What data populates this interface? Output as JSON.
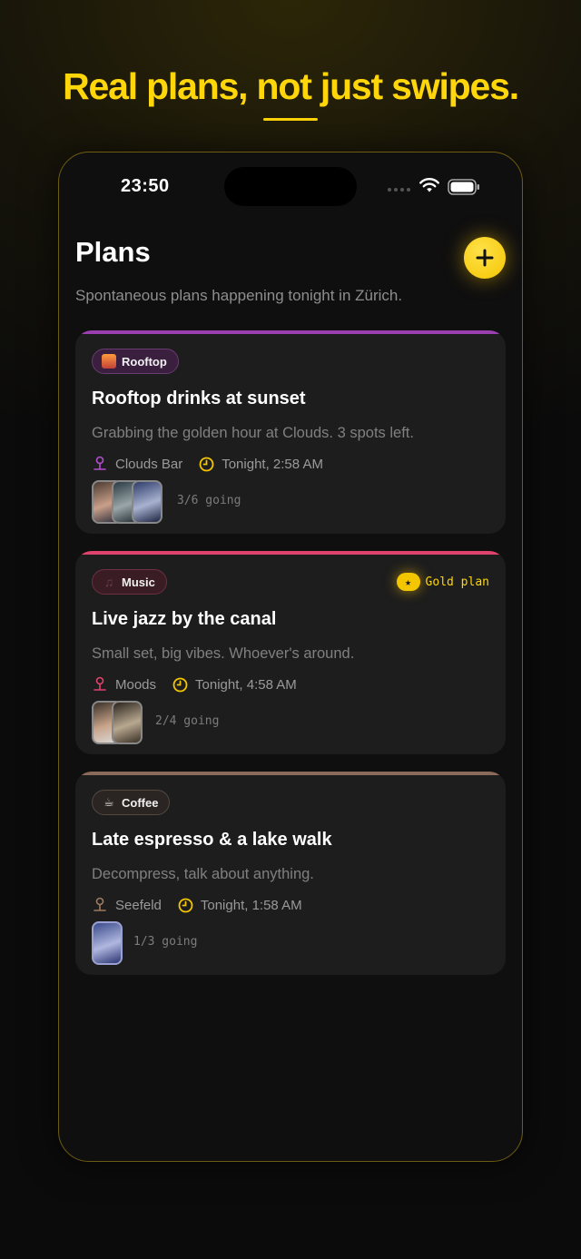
{
  "headline": "Real plans, not just swipes.",
  "status": {
    "time": "23:50"
  },
  "header": {
    "title": "Plans",
    "subtitle": "Spontaneous plans happening tonight in Zürich.",
    "add_icon": "plus-icon"
  },
  "colors": {
    "accent": "#ffd60a",
    "rooftop": "#9b3fb0",
    "music": "#e0426e",
    "coffee": "#8a6a5a"
  },
  "plans": [
    {
      "tag": "Rooftop",
      "title": "Rooftop drinks at sunset",
      "description": "Grabbing the golden hour at Clouds. 3 spots left.",
      "location": "Clouds Bar",
      "time": "Tonight, 2:58 AM",
      "going": "3/6 going"
    },
    {
      "tag": "Music",
      "badge": "Gold plan",
      "title": "Live jazz by the canal",
      "description": "Small set, big vibes. Whoever's around.",
      "location": "Moods",
      "time": "Tonight, 4:58 AM",
      "going": "2/4 going"
    },
    {
      "tag": "Coffee",
      "title": "Late espresso & a lake walk",
      "description": "Decompress, talk about anything.",
      "location": "Seefeld",
      "time": "Tonight, 1:58 AM",
      "going": "1/3 going"
    }
  ]
}
